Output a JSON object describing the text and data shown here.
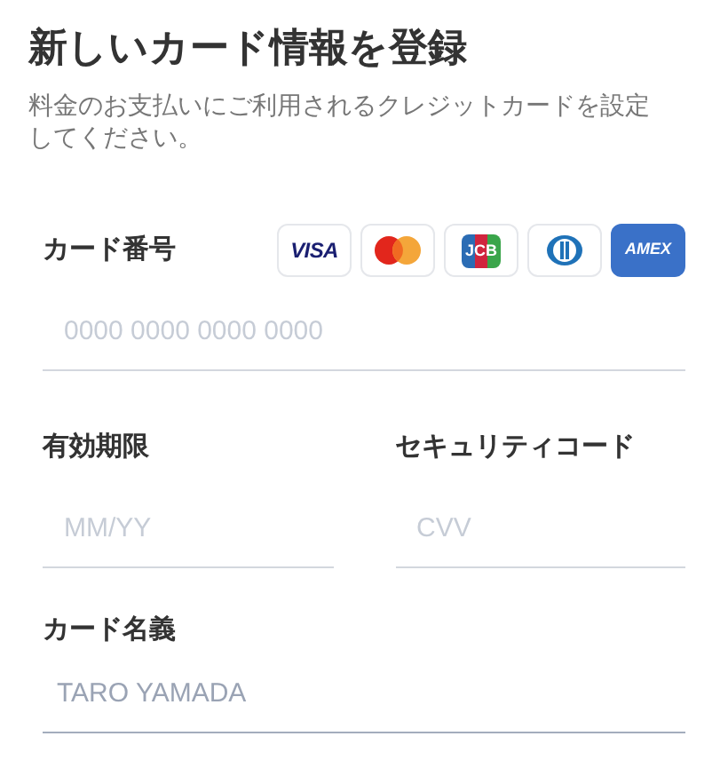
{
  "title": "新しいカード情報を登録",
  "description": "料金のお支払いにご利用されるクレジットカードを設定してください。",
  "card_number": {
    "label": "カード番号",
    "placeholder": "0000 0000 0000 0000",
    "focused": false,
    "brands": [
      {
        "kind": "visa",
        "label": "VISA"
      },
      {
        "kind": "mastercard"
      },
      {
        "kind": "jcb",
        "label": "JCB"
      },
      {
        "kind": "diners"
      },
      {
        "kind": "amex",
        "label": "AMEX"
      }
    ]
  },
  "expiry": {
    "label": "有効期限",
    "placeholder": "MM/YY",
    "focused": false
  },
  "security_code": {
    "label": "セキュリティコード",
    "placeholder": "CVV",
    "focused": false
  },
  "card_name": {
    "label": "カード名義",
    "placeholder": "TARO YAMADA",
    "focused": true
  }
}
